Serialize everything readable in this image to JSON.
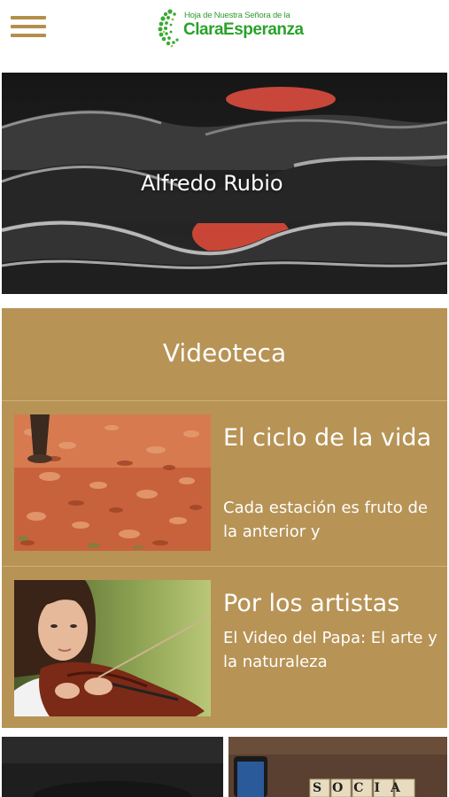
{
  "header": {
    "logo_small": "Hoja de Nuestra Señora de la",
    "logo_big": "ClaraEsperanza",
    "menu_icon": "hamburger-menu-icon",
    "accent_color": "#b48f4c",
    "logo_color": "#2ba22b"
  },
  "hero": {
    "title": "Alfredo Rubio"
  },
  "videoteca": {
    "heading": "Videoteca",
    "background_color": "#b79355",
    "items": [
      {
        "title": "El ciclo de la vida",
        "description": "Cada estación es fruto de la anterior y"
      },
      {
        "title": "Por los artistas",
        "description": "El Video del Papa: El arte y la naturaleza"
      }
    ]
  },
  "tiles": {
    "right_text": "SOCIA"
  }
}
